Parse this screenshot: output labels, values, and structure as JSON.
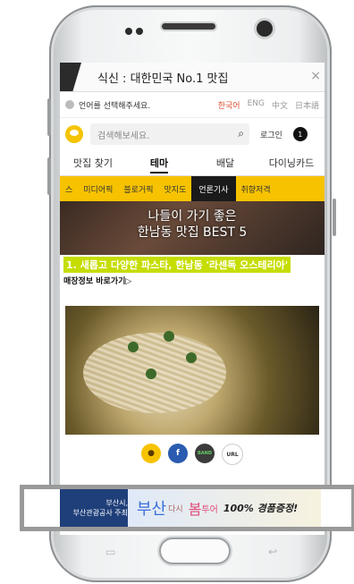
{
  "app": {
    "title": "식신 : 대한민국 No.1 맛집",
    "close": "×"
  },
  "language_bar": {
    "prompt": "언어를 선택해주세요.",
    "languages": [
      "한국어",
      "ENG",
      "中文",
      "日本語"
    ],
    "active_color": "#e05030"
  },
  "search": {
    "placeholder": "검색해보세요.",
    "login_label": "로그인",
    "badge_count": "1"
  },
  "tabs": [
    "맛집 찾기",
    "테마",
    "배달",
    "다이닝카드"
  ],
  "categories": [
    "스",
    "미디어픽",
    "블로거픽",
    "맛지도",
    "언론기사",
    "취향저격"
  ],
  "hero": {
    "line1": "나들이 가기 좋은",
    "line2": "한남동 맛집 BEST 5"
  },
  "article": {
    "headline": "1. 새롭고 다양한 파스타, 한남동 '라센독 오스테리아'",
    "link": "매장정보 바로가기▷"
  },
  "share_buttons": [
    "talk",
    "f",
    "BAND",
    "URL"
  ],
  "banner": {
    "left_line1": "부산시,",
    "left_line2": "부산관광공사 주최",
    "busan": "부산",
    "dasi": "다시",
    "bom": "봄",
    "tour": "투어",
    "prize": "100% 경품증정!"
  },
  "colors": {
    "category_bar": "#f7c300",
    "headline_bg": "#c6dd00",
    "banner_left": "#1f3f7a"
  }
}
